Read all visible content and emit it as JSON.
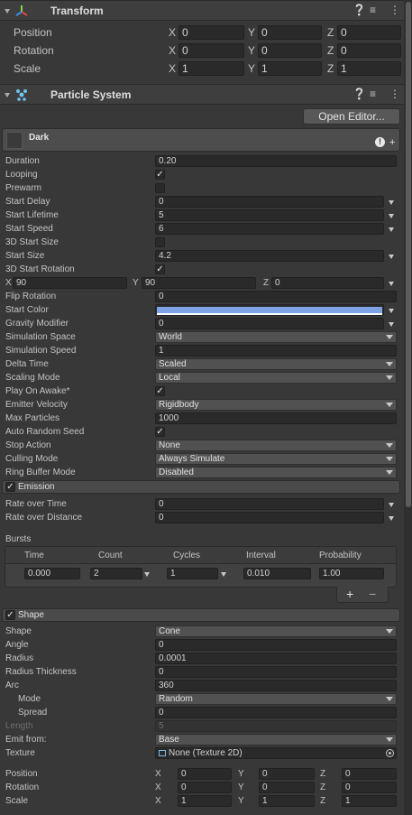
{
  "transform": {
    "title": "Transform",
    "rows": [
      {
        "label": "Position",
        "x": "0",
        "y": "0",
        "z": "0"
      },
      {
        "label": "Rotation",
        "x": "0",
        "y": "0",
        "z": "0"
      },
      {
        "label": "Scale",
        "x": "1",
        "y": "1",
        "z": "1"
      }
    ]
  },
  "particle_system": {
    "title": "Particle System",
    "open_editor": "Open Editor...",
    "system_name": "Dark"
  },
  "axis": {
    "x": "X",
    "y": "Y",
    "z": "Z"
  },
  "main": {
    "duration": {
      "label": "Duration",
      "value": "0.20"
    },
    "looping": {
      "label": "Looping",
      "checked": true
    },
    "prewarm": {
      "label": "Prewarm",
      "checked": false
    },
    "start_delay": {
      "label": "Start Delay",
      "value": "0"
    },
    "start_lifetime": {
      "label": "Start Lifetime",
      "value": "5"
    },
    "start_speed": {
      "label": "Start Speed",
      "value": "6"
    },
    "start_size_3d": {
      "label": "3D Start Size",
      "checked": false
    },
    "start_size": {
      "label": "Start Size",
      "value": "4.2"
    },
    "start_rotation_3d": {
      "label": "3D Start Rotation",
      "checked": true
    },
    "rotation_xyz": {
      "x": "90",
      "y": "90",
      "z": "0"
    },
    "flip_rotation": {
      "label": "Flip Rotation",
      "value": "0"
    },
    "start_color": {
      "label": "Start Color",
      "color": "#7da2e6"
    },
    "gravity_modifier": {
      "label": "Gravity Modifier",
      "value": "0"
    },
    "simulation_space": {
      "label": "Simulation Space",
      "value": "World"
    },
    "simulation_speed": {
      "label": "Simulation Speed",
      "value": "1"
    },
    "delta_time": {
      "label": "Delta Time",
      "value": "Scaled"
    },
    "scaling_mode": {
      "label": "Scaling Mode",
      "value": "Local"
    },
    "play_on_awake": {
      "label": "Play On Awake*",
      "checked": true
    },
    "emitter_velocity": {
      "label": "Emitter Velocity",
      "value": "Rigidbody"
    },
    "max_particles": {
      "label": "Max Particles",
      "value": "1000"
    },
    "auto_random_seed": {
      "label": "Auto Random Seed",
      "checked": true
    },
    "stop_action": {
      "label": "Stop Action",
      "value": "None"
    },
    "culling_mode": {
      "label": "Culling Mode",
      "value": "Always Simulate"
    },
    "ring_buffer_mode": {
      "label": "Ring Buffer Mode",
      "value": "Disabled"
    }
  },
  "emission": {
    "title": "Emission",
    "enabled": true,
    "rate_over_time": {
      "label": "Rate over Time",
      "value": "0"
    },
    "rate_over_distance": {
      "label": "Rate over Distance",
      "value": "0"
    },
    "bursts_label": "Bursts",
    "bursts_columns": [
      "Time",
      "Count",
      "Cycles",
      "Interval",
      "Probability"
    ],
    "bursts_rows": [
      {
        "time": "0.000",
        "count": "2",
        "cycles": "1",
        "interval": "0.010",
        "probability": "1.00"
      }
    ],
    "add": "+",
    "remove": "−"
  },
  "shape": {
    "title": "Shape",
    "enabled": true,
    "shape": {
      "label": "Shape",
      "value": "Cone"
    },
    "angle": {
      "label": "Angle",
      "value": "0"
    },
    "radius": {
      "label": "Radius",
      "value": "0.0001"
    },
    "radius_thickness": {
      "label": "Radius Thickness",
      "value": "0"
    },
    "arc": {
      "label": "Arc",
      "value": "360"
    },
    "mode": {
      "label": "Mode",
      "value": "Random"
    },
    "spread": {
      "label": "Spread",
      "value": "0"
    },
    "length": {
      "label": "Length",
      "value": "5"
    },
    "emit_from": {
      "label": "Emit from:",
      "value": "Base"
    },
    "texture": {
      "label": "Texture",
      "value": "None (Texture 2D)"
    },
    "position": {
      "label": "Position",
      "x": "0",
      "y": "0",
      "z": "0"
    },
    "rotation": {
      "label": "Rotation",
      "x": "0",
      "y": "0",
      "z": "0"
    },
    "scale": {
      "label": "Scale",
      "x": "1",
      "y": "1",
      "z": "1"
    }
  },
  "icons": {
    "fold": "foldout-arrow-icon",
    "transform": "transform-axes-icon",
    "particle": "particle-system-icon",
    "help": "help-icon",
    "presets": "presets-sliders-icon",
    "menu": "kebab-menu-icon"
  }
}
